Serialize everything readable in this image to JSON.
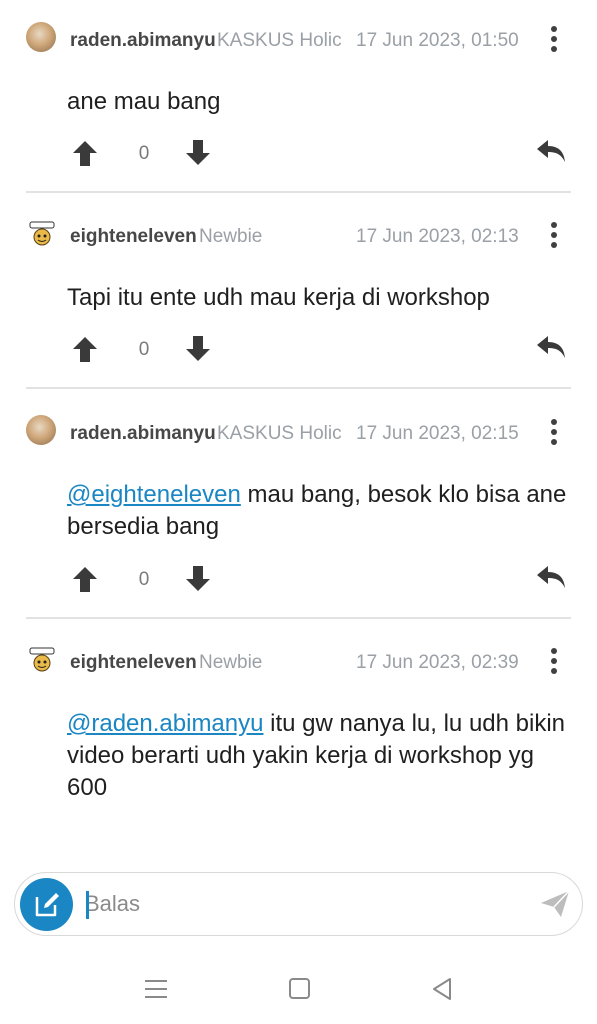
{
  "comments": [
    {
      "username": "raden.abimanyu",
      "rank": "KASKUS Holic",
      "date": "17 Jun 2023, 01:50",
      "mention": "",
      "text": "ane mau bang",
      "votes": "0",
      "avatar": "photo-avatar"
    },
    {
      "username": "eighteneleven",
      "rank": "Newbie",
      "date": "17 Jun 2023, 02:13",
      "mention": "",
      "text": "Tapi itu ente udh mau kerja di workshop",
      "votes": "0",
      "avatar": "newbie-badge-avatar"
    },
    {
      "username": "raden.abimanyu",
      "rank": "KASKUS Holic",
      "date": "17 Jun 2023, 02:15",
      "mention": "@eighteneleven",
      "text": " mau bang, besok klo bisa ane bersedia bang",
      "votes": "0",
      "avatar": "photo-avatar"
    },
    {
      "username": "eighteneleven",
      "rank": "Newbie",
      "date": "17 Jun 2023, 02:39",
      "mention": "@raden.abimanyu",
      "text": " itu gw nanya lu, lu udh bikin video berarti udh yakin kerja di workshop yg 600",
      "votes": "0",
      "avatar": "newbie-badge-avatar"
    }
  ],
  "composer": {
    "placeholder": "Balas",
    "compose_icon": "edit-icon",
    "send_icon": "send-icon"
  },
  "icons": {
    "upvote": "arrow-up-icon",
    "downvote": "arrow-down-icon",
    "reply": "reply-icon",
    "more": "more-vertical-icon"
  },
  "colors": {
    "accent": "#1a86c4",
    "username": "#474747",
    "muted": "#9aa0a6"
  }
}
